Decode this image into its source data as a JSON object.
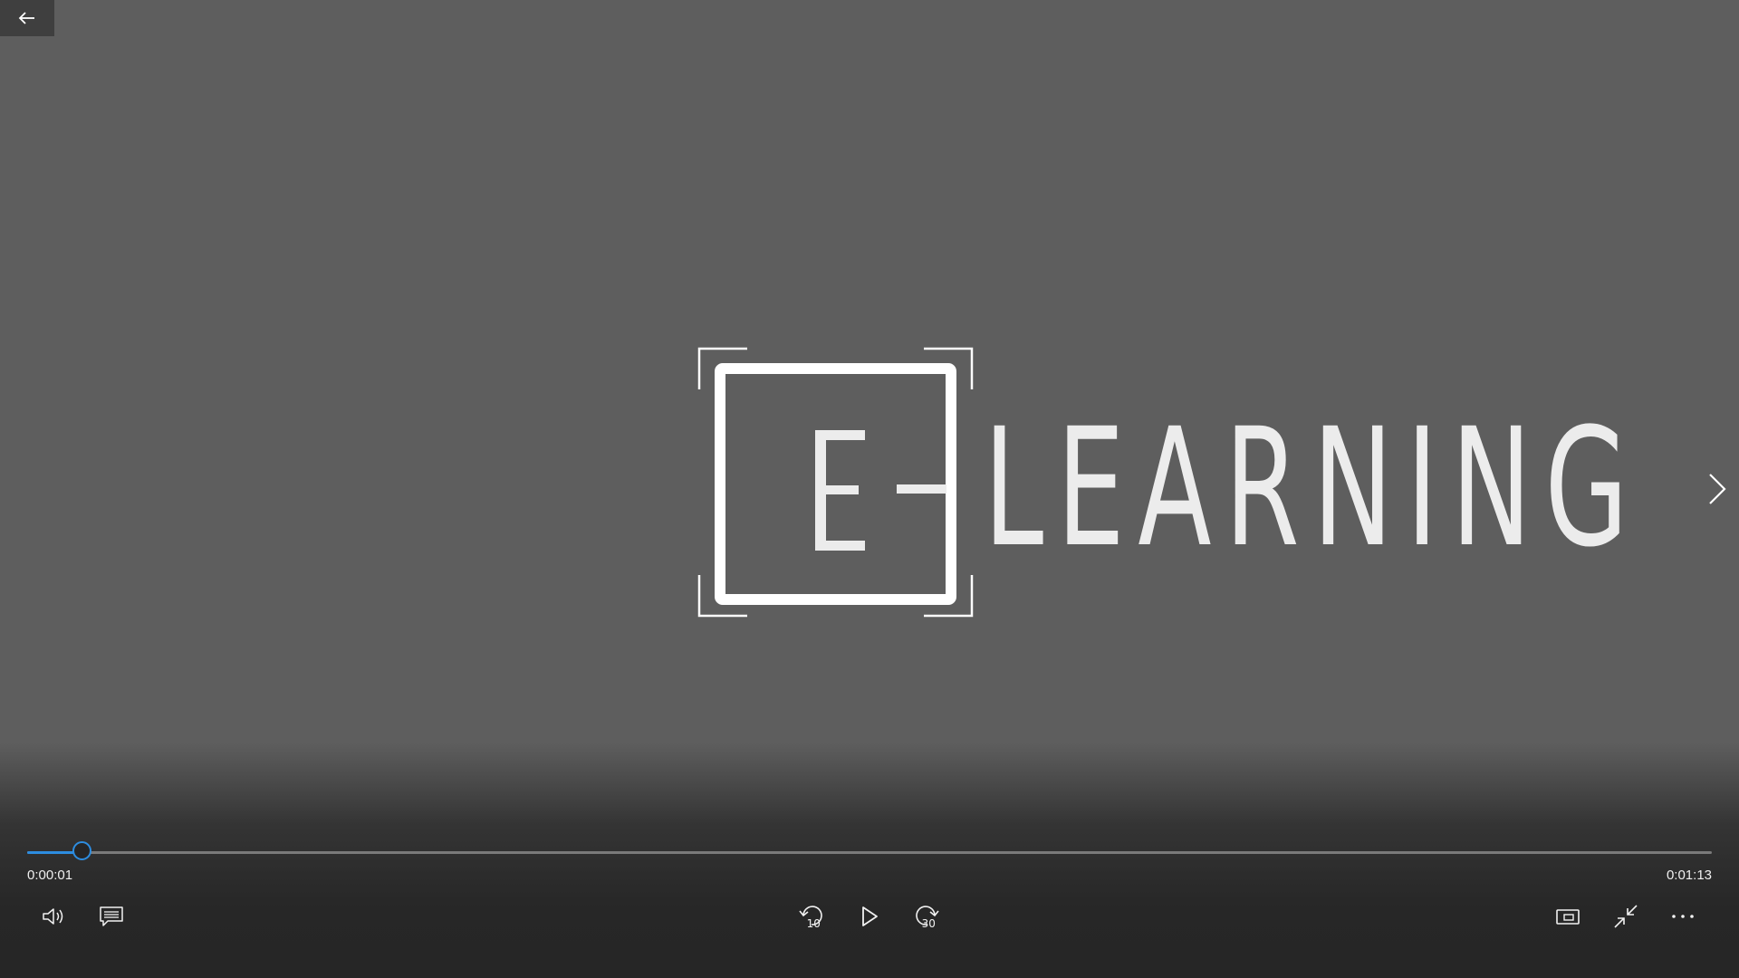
{
  "video": {
    "logo_text": "E LEARNING",
    "logo_word": "LEARNING",
    "logo_letter": "E"
  },
  "player": {
    "elapsed_time": "0:00:01",
    "total_time": "0:01:13",
    "progress_fraction": 0.032,
    "skip_back_seconds": "10",
    "skip_forward_seconds": "30"
  },
  "colors": {
    "accent": "#2d8de0",
    "background": "#5e5e5e",
    "controls_bar": "#262626"
  },
  "icons": {
    "back": "arrow-left-icon",
    "next": "chevron-right-icon",
    "volume": "volume-icon",
    "captions": "captions-icon",
    "skip_back": "skip-back-10-icon",
    "play": "play-icon",
    "skip_forward": "skip-forward-30-icon",
    "mini_view": "mini-view-icon",
    "exit_fullscreen": "exit-fullscreen-icon",
    "more": "more-options-icon"
  }
}
